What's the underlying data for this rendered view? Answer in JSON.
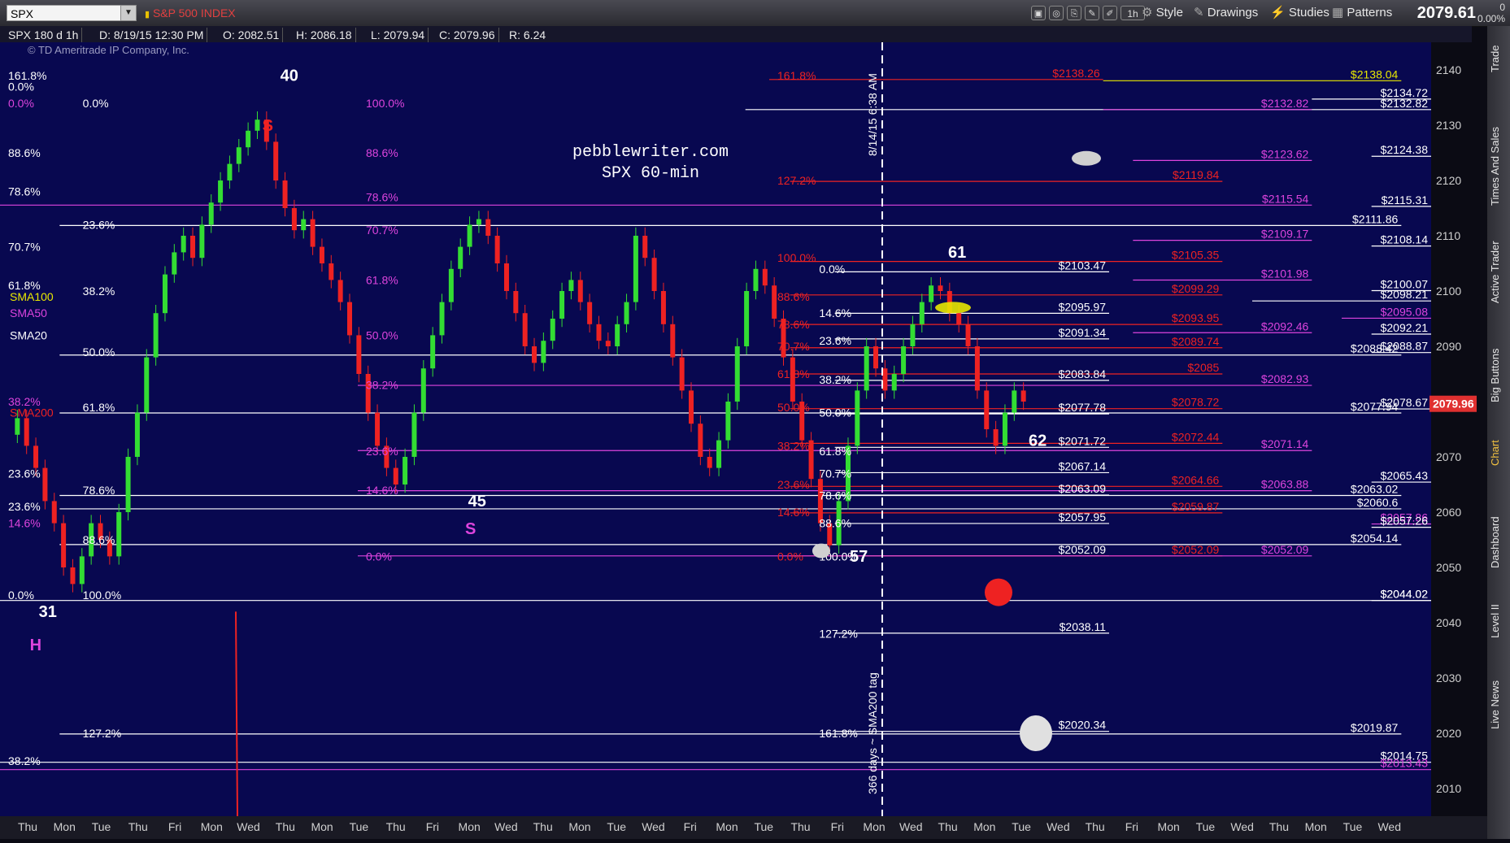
{
  "toolbar": {
    "symbol": "SPX",
    "symbol_name": "S&P 500 INDEX",
    "aggregation": "1h",
    "style_label": "Style",
    "drawings_label": "Drawings",
    "studies_label": "Studies",
    "patterns_label": "Patterns",
    "last_price": "2079.61",
    "change_line1": "0",
    "change_line2": "0.00%"
  },
  "info": {
    "desc": "SPX 180 d 1h",
    "date": "D: 8/19/15 12:30 PM",
    "open": "O: 2082.51",
    "high": "H: 2086.18",
    "low": "L: 2079.94",
    "close": "C: 2079.96",
    "range": "R: 6.24"
  },
  "copyright": "© TD Ameritrade IP Company, Inc.",
  "sidebar": [
    "Trade",
    "Times And Sales",
    "Active Trader",
    "Big Buttons",
    "Chart",
    "Dashboard",
    "Level II",
    "Live News"
  ],
  "colors": {
    "background": "#080850",
    "red": "#ee2222",
    "magenta": "#dd44dd",
    "white": "#ffffff",
    "yellow": "#e8e800",
    "candle_up": "#33dd33",
    "candle_down": "#ee2222",
    "price_tag": "#e03030"
  },
  "chart_data": {
    "type": "line",
    "title": "pebblewriter.com",
    "subtitle": "SPX 60-min",
    "xlabel": "",
    "ylabel": "",
    "ylim": [
      2005,
      2145
    ],
    "y_ticks": [
      2010,
      2020,
      2030,
      2040,
      2050,
      2060,
      2070,
      2080,
      2090,
      2100,
      2110,
      2120,
      2130,
      2140
    ],
    "x_ticks": [
      "Thu",
      "Mon",
      "Tue",
      "Thu",
      "Fri",
      "Mon",
      "Wed",
      "Thu",
      "Mon",
      "Tue",
      "Thu",
      "Fri",
      "Mon",
      "Wed",
      "Thu",
      "Mon",
      "Tue",
      "Wed",
      "Fri",
      "Mon",
      "Tue",
      "Thu",
      "Fri",
      "Mon",
      "Wed",
      "Thu",
      "Mon",
      "Tue",
      "Wed",
      "Thu",
      "Fri",
      "Mon",
      "Tue",
      "Wed",
      "Thu",
      "Mon",
      "Tue",
      "Wed"
    ],
    "current_price": "2079.96",
    "series": [
      {
        "name": "SPX",
        "values": [
          2074,
          2077,
          2072,
          2068,
          2062,
          2058,
          2050,
          2047,
          2052,
          2058,
          2055,
          2052,
          2060,
          2070,
          2078,
          2088,
          2096,
          2103,
          2107,
          2110,
          2106,
          2112,
          2116,
          2120,
          2123,
          2126,
          2129,
          2131,
          2127,
          2120,
          2115,
          2111,
          2113,
          2108,
          2105,
          2102,
          2098,
          2092,
          2085,
          2078,
          2072,
          2068,
          2065,
          2070,
          2078,
          2086,
          2092,
          2098,
          2104,
          2108,
          2112,
          2113,
          2110,
          2105,
          2100,
          2096,
          2090,
          2087,
          2091,
          2095,
          2100,
          2102,
          2098,
          2094,
          2091,
          2090,
          2094,
          2098,
          2110,
          2106,
          2100,
          2094,
          2088,
          2082,
          2076,
          2070,
          2068,
          2073,
          2080,
          2090,
          2100,
          2104,
          2101,
          2095,
          2088,
          2080,
          2073,
          2066,
          2058,
          2054,
          2062,
          2072,
          2082,
          2090,
          2086,
          2082,
          2085,
          2090,
          2094,
          2098,
          2101,
          2100,
          2096,
          2094,
          2090,
          2082,
          2075,
          2072,
          2078,
          2082,
          2080
        ]
      }
    ],
    "wave_labels": [
      {
        "text": "40",
        "x": 94,
        "y": 2138
      },
      {
        "text": "S",
        "x": 88,
        "y": 2129,
        "color": "red"
      },
      {
        "text": "45",
        "x": 157,
        "y": 2061
      },
      {
        "text": "S",
        "x": 156,
        "y": 2056,
        "color": "magenta"
      },
      {
        "text": "31",
        "x": 13,
        "y": 2041
      },
      {
        "text": "H",
        "x": 10,
        "y": 2035,
        "color": "magenta"
      },
      {
        "text": "61",
        "x": 318,
        "y": 2106
      },
      {
        "text": "62",
        "x": 345,
        "y": 2072
      },
      {
        "text": "57",
        "x": 285,
        "y": 2051
      }
    ],
    "hlines": [
      {
        "price": 2138.04,
        "label": "$2138.04",
        "color": "yellow",
        "x0": 370,
        "x1": 470
      },
      {
        "price": 2138.26,
        "label": "$2138.26",
        "color": "red",
        "x0": 258,
        "x1": 370
      },
      {
        "price": 2134.72,
        "label": "$2134.72",
        "color": "white",
        "x0": 440,
        "x1": 480
      },
      {
        "price": 2132.82,
        "label": "$2132.82",
        "color": "white",
        "x0": 250,
        "x1": 480
      },
      {
        "price": 2132.82,
        "label": "$2132.82",
        "color": "magenta",
        "x0": 370,
        "x1": 440
      },
      {
        "price": 2124.38,
        "label": "$2124.38",
        "color": "white",
        "x0": 460,
        "x1": 480
      },
      {
        "price": 2123.62,
        "label": "$2123.62",
        "color": "magenta",
        "x0": 380,
        "x1": 440
      },
      {
        "price": 2119.84,
        "label": "$2119.84",
        "color": "red",
        "x0": 265,
        "x1": 410
      },
      {
        "price": 2115.54,
        "label": "$2115.54",
        "color": "magenta",
        "x0": 0,
        "x1": 440
      },
      {
        "price": 2115.31,
        "label": "$2115.31",
        "color": "white",
        "x0": 460,
        "x1": 480
      },
      {
        "price": 2111.86,
        "label": "$2111.86",
        "color": "white",
        "x0": 20,
        "x1": 470
      },
      {
        "price": 2109.17,
        "label": "$2109.17",
        "color": "magenta",
        "x0": 380,
        "x1": 440
      },
      {
        "price": 2108.14,
        "label": "$2108.14",
        "color": "white",
        "x0": 460,
        "x1": 480
      },
      {
        "price": 2105.35,
        "label": "$2105.35",
        "color": "red",
        "x0": 265,
        "x1": 410
      },
      {
        "price": 2103.47,
        "label": "$2103.47",
        "color": "white",
        "x0": 280,
        "x1": 372
      },
      {
        "price": 2101.98,
        "label": "$2101.98",
        "color": "magenta",
        "x0": 380,
        "x1": 440
      },
      {
        "price": 2100.07,
        "label": "$2100.07",
        "color": "white",
        "x0": 460,
        "x1": 480
      },
      {
        "price": 2099.29,
        "label": "$2099.29",
        "color": "red",
        "x0": 265,
        "x1": 410
      },
      {
        "price": 2098.21,
        "label": "$2098.21",
        "color": "white",
        "x0": 420,
        "x1": 480
      },
      {
        "price": 2095.97,
        "label": "$2095.97",
        "color": "white",
        "x0": 280,
        "x1": 372
      },
      {
        "price": 2095.08,
        "label": "$2095.08",
        "color": "magenta",
        "x0": 450,
        "x1": 480
      },
      {
        "price": 2093.95,
        "label": "$2093.95",
        "color": "red",
        "x0": 265,
        "x1": 410
      },
      {
        "price": 2092.46,
        "label": "$2092.46",
        "color": "magenta",
        "x0": 380,
        "x1": 440
      },
      {
        "price": 2092.21,
        "label": "$2092.21",
        "color": "white",
        "x0": 460,
        "x1": 480
      },
      {
        "price": 2091.34,
        "label": "$2091.34",
        "color": "white",
        "x0": 280,
        "x1": 372
      },
      {
        "price": 2089.74,
        "label": "$2089.74",
        "color": "red",
        "x0": 265,
        "x1": 410
      },
      {
        "price": 2088.87,
        "label": "$2088.87",
        "color": "white",
        "x0": 460,
        "x1": 480
      },
      {
        "price": 2088.42,
        "label": "$2088.42",
        "color": "white",
        "x0": 20,
        "x1": 470
      },
      {
        "price": 2085,
        "label": "$2085",
        "color": "red",
        "x0": 265,
        "x1": 410
      },
      {
        "price": 2083.84,
        "label": "$2083.84",
        "color": "white",
        "x0": 280,
        "x1": 372
      },
      {
        "price": 2082.93,
        "label": "$2082.93",
        "color": "magenta",
        "x0": 120,
        "x1": 440
      },
      {
        "price": 2078.72,
        "label": "$2078.72",
        "color": "red",
        "x0": 265,
        "x1": 410
      },
      {
        "price": 2078.67,
        "label": "$2078.67",
        "color": "white",
        "x0": 460,
        "x1": 480
      },
      {
        "price": 2077.94,
        "label": "$2077.94",
        "color": "white",
        "x0": 20,
        "x1": 470
      },
      {
        "price": 2077.78,
        "label": "$2077.78",
        "color": "white",
        "x0": 280,
        "x1": 372
      },
      {
        "price": 2072.44,
        "label": "$2072.44",
        "color": "red",
        "x0": 265,
        "x1": 410
      },
      {
        "price": 2071.72,
        "label": "$2071.72",
        "color": "white",
        "x0": 280,
        "x1": 372
      },
      {
        "price": 2071.14,
        "label": "$2071.14",
        "color": "magenta",
        "x0": 120,
        "x1": 440
      },
      {
        "price": 2067.14,
        "label": "$2067.14",
        "color": "white",
        "x0": 280,
        "x1": 372
      },
      {
        "price": 2065.43,
        "label": "$2065.43",
        "color": "white",
        "x0": 460,
        "x1": 480
      },
      {
        "price": 2064.66,
        "label": "$2064.66",
        "color": "red",
        "x0": 265,
        "x1": 410
      },
      {
        "price": 2063.88,
        "label": "$2063.88",
        "color": "magenta",
        "x0": 120,
        "x1": 440
      },
      {
        "price": 2063.09,
        "label": "$2063.09",
        "color": "white",
        "x0": 280,
        "x1": 372
      },
      {
        "price": 2063.02,
        "label": "$2063.02",
        "color": "white",
        "x0": 20,
        "x1": 470
      },
      {
        "price": 2060.6,
        "label": "$2060.6",
        "color": "white",
        "x0": 20,
        "x1": 470
      },
      {
        "price": 2059.87,
        "label": "$2059.87",
        "color": "red",
        "x0": 265,
        "x1": 410
      },
      {
        "price": 2057.95,
        "label": "$2057.95",
        "color": "white",
        "x0": 280,
        "x1": 372
      },
      {
        "price": 2057.86,
        "label": "$2057.86",
        "color": "magenta",
        "x0": 460,
        "x1": 480
      },
      {
        "price": 2057.26,
        "label": "$2057.26",
        "color": "white",
        "x0": 460,
        "x1": 480
      },
      {
        "price": 2054.14,
        "label": "$2054.14",
        "color": "white",
        "x0": 20,
        "x1": 470
      },
      {
        "price": 2052.09,
        "label": "$2052.09",
        "color": "white",
        "x0": 280,
        "x1": 372
      },
      {
        "price": 2052.09,
        "label": "$2052.09",
        "color": "red",
        "x0": 265,
        "x1": 410
      },
      {
        "price": 2052.09,
        "label": "$2052.09",
        "color": "magenta",
        "x0": 120,
        "x1": 440
      },
      {
        "price": 2044.02,
        "label": "$2044.02",
        "color": "white",
        "x0": 0,
        "x1": 480
      },
      {
        "price": 2044.02,
        "label": "$2044.02",
        "color": "white",
        "x0": 460,
        "x1": 480
      },
      {
        "price": 2038.11,
        "label": "$2038.11",
        "color": "white",
        "x0": 280,
        "x1": 372
      },
      {
        "price": 2020.34,
        "label": "$2020.34",
        "color": "white",
        "x0": 280,
        "x1": 372
      },
      {
        "price": 2019.87,
        "label": "$2019.87",
        "color": "white",
        "x0": 20,
        "x1": 470
      },
      {
        "price": 2014.75,
        "label": "$2014.75",
        "color": "white",
        "x0": 0,
        "x1": 480
      },
      {
        "price": 2013.43,
        "label": "$2013.43",
        "color": "magenta",
        "x0": 0,
        "x1": 480
      }
    ],
    "fib_labels": [
      {
        "text": "161.8%",
        "x": 0,
        "y": 2139,
        "color": "white"
      },
      {
        "text": "0.0%",
        "x": 0,
        "y": 2137,
        "color": "white"
      },
      {
        "text": "0.0%",
        "x": 0,
        "y": 2134,
        "color": "magenta"
      },
      {
        "text": "0.0%",
        "x": 25,
        "y": 2134,
        "color": "white"
      },
      {
        "text": "88.6%",
        "x": 0,
        "y": 2125,
        "color": "white"
      },
      {
        "text": "78.6%",
        "x": 0,
        "y": 2118,
        "color": "white"
      },
      {
        "text": "23.6%",
        "x": 25,
        "y": 2112,
        "color": "white"
      },
      {
        "text": "70.7%",
        "x": 0,
        "y": 2108,
        "color": "white"
      },
      {
        "text": "61.8%",
        "x": 0,
        "y": 2101,
        "color": "white"
      },
      {
        "text": "38.2%",
        "x": 25,
        "y": 2100,
        "color": "white"
      },
      {
        "text": "50.0%",
        "x": 25,
        "y": 2089,
        "color": "white"
      },
      {
        "text": "38.2%",
        "x": 0,
        "y": 2080,
        "color": "magenta"
      },
      {
        "text": "61.8%",
        "x": 25,
        "y": 2079,
        "color": "white"
      },
      {
        "text": "23.6%",
        "x": 0,
        "y": 2067,
        "color": "white"
      },
      {
        "text": "78.6%",
        "x": 25,
        "y": 2064,
        "color": "white"
      },
      {
        "text": "23.6%",
        "x": 0,
        "y": 2061,
        "color": "white"
      },
      {
        "text": "14.6%",
        "x": 0,
        "y": 2058,
        "color": "magenta"
      },
      {
        "text": "88.6%",
        "x": 25,
        "y": 2055,
        "color": "white"
      },
      {
        "text": "0.0%",
        "x": 0,
        "y": 2045,
        "color": "white"
      },
      {
        "text": "100.0%",
        "x": 25,
        "y": 2045,
        "color": "white"
      },
      {
        "text": "127.2%",
        "x": 25,
        "y": 2020,
        "color": "white"
      },
      {
        "text": "38.2%",
        "x": 0,
        "y": 2015,
        "color": "white"
      },
      {
        "text": "161.8%",
        "x": 258,
        "y": 2139,
        "color": "red"
      },
      {
        "text": "100.0%",
        "x": 120,
        "y": 2134,
        "color": "magenta"
      },
      {
        "text": "88.6%",
        "x": 120,
        "y": 2125,
        "color": "magenta"
      },
      {
        "text": "127.2%",
        "x": 258,
        "y": 2120,
        "color": "red"
      },
      {
        "text": "78.6%",
        "x": 120,
        "y": 2117,
        "color": "magenta"
      },
      {
        "text": "70.7%",
        "x": 120,
        "y": 2111,
        "color": "magenta"
      },
      {
        "text": "100.0%",
        "x": 258,
        "y": 2106,
        "color": "red"
      },
      {
        "text": "0.0%",
        "x": 272,
        "y": 2104,
        "color": "white"
      },
      {
        "text": "61.8%",
        "x": 120,
        "y": 2102,
        "color": "magenta"
      },
      {
        "text": "88.6%",
        "x": 258,
        "y": 2099,
        "color": "red"
      },
      {
        "text": "14.6%",
        "x": 272,
        "y": 2096,
        "color": "white"
      },
      {
        "text": "78.6%",
        "x": 258,
        "y": 2094,
        "color": "red"
      },
      {
        "text": "50.0%",
        "x": 120,
        "y": 2092,
        "color": "magenta"
      },
      {
        "text": "23.6%",
        "x": 272,
        "y": 2091,
        "color": "white"
      },
      {
        "text": "70.7%",
        "x": 258,
        "y": 2090,
        "color": "red"
      },
      {
        "text": "61.8%",
        "x": 258,
        "y": 2085,
        "color": "red"
      },
      {
        "text": "38.2%",
        "x": 272,
        "y": 2084,
        "color": "white"
      },
      {
        "text": "38.2%",
        "x": 120,
        "y": 2083,
        "color": "magenta"
      },
      {
        "text": "50.0%",
        "x": 258,
        "y": 2079,
        "color": "red"
      },
      {
        "text": "50.0%",
        "x": 272,
        "y": 2078,
        "color": "white"
      },
      {
        "text": "38.2%",
        "x": 258,
        "y": 2072,
        "color": "red"
      },
      {
        "text": "23.6%",
        "x": 120,
        "y": 2071,
        "color": "magenta"
      },
      {
        "text": "61.8%",
        "x": 272,
        "y": 2071,
        "color": "white"
      },
      {
        "text": "70.7%",
        "x": 272,
        "y": 2067,
        "color": "white"
      },
      {
        "text": "23.6%",
        "x": 258,
        "y": 2065,
        "color": "red"
      },
      {
        "text": "14.6%",
        "x": 120,
        "y": 2064,
        "color": "magenta"
      },
      {
        "text": "78.6%",
        "x": 272,
        "y": 2063,
        "color": "white"
      },
      {
        "text": "14.6%",
        "x": 258,
        "y": 2060,
        "color": "red"
      },
      {
        "text": "88.6%",
        "x": 272,
        "y": 2058,
        "color": "white"
      },
      {
        "text": "0.0%",
        "x": 258,
        "y": 2052,
        "color": "red"
      },
      {
        "text": "100.0%",
        "x": 272,
        "y": 2052,
        "color": "white"
      },
      {
        "text": "0.0%",
        "x": 120,
        "y": 2052,
        "color": "magenta"
      },
      {
        "text": "127.2%",
        "x": 272,
        "y": 2038,
        "color": "white"
      },
      {
        "text": "161.8%",
        "x": 272,
        "y": 2020,
        "color": "white"
      }
    ],
    "sma_labels": [
      {
        "text": "SMA100",
        "x": 0,
        "y": 2099,
        "color": "yellow"
      },
      {
        "text": "SMA50",
        "x": 0,
        "y": 2096,
        "color": "magenta"
      },
      {
        "text": "SMA20",
        "x": 0,
        "y": 2092,
        "color": "white"
      },
      {
        "text": "SMA200",
        "x": 0,
        "y": 2078,
        "color": "red"
      }
    ],
    "annotations": [
      {
        "text": "8/14/15 6:38 AM"
      },
      {
        "text": "366 days ~ SMA200 tag"
      }
    ]
  }
}
